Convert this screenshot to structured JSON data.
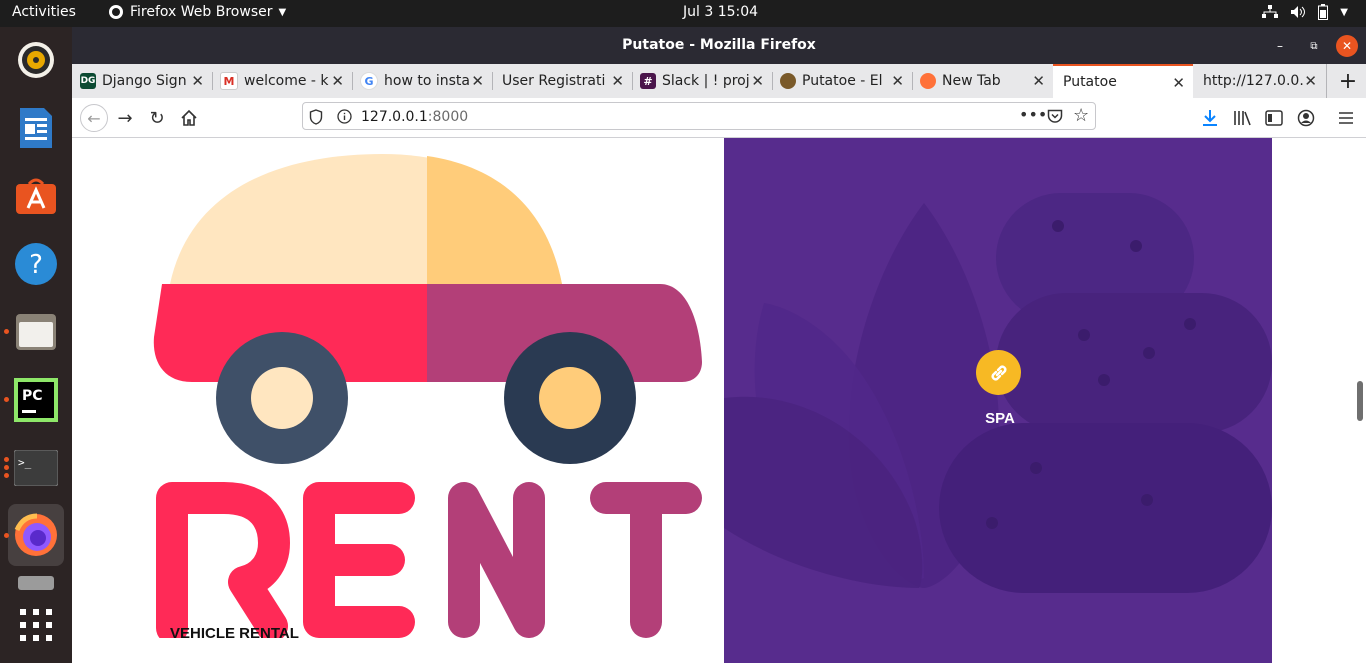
{
  "topbar": {
    "activities": "Activities",
    "app_menu": "Firefox Web Browser",
    "clock": "Jul 3  15:04"
  },
  "window": {
    "title": "Putatoe - Mozilla Firefox"
  },
  "tabs": [
    {
      "label": "Django Sign"
    },
    {
      "label": "welcome - k"
    },
    {
      "label": "how to insta"
    },
    {
      "label": "User Registrati"
    },
    {
      "label": "Slack | ! proj"
    },
    {
      "label": "Putatoe - El"
    },
    {
      "label": "New Tab"
    },
    {
      "label": "Putatoe"
    },
    {
      "label": "http://127.0.0."
    }
  ],
  "urlbar": {
    "host": "127.0.0.1",
    "port": ":8000"
  },
  "content": {
    "left_card_label": "VEHICLE RENTAL",
    "rent_text": "RENT",
    "right_card_label": "SPA"
  },
  "colors": {
    "accent": "#e95420",
    "spa_bg": "#572c8d",
    "spa_icon": "#f7b924",
    "car_red": "#ff2a57",
    "car_pink": "#b33f78",
    "car_cream": "#ffe6c0",
    "car_yellow": "#ffcc7a",
    "wheel_dark": "#3f5068"
  },
  "icons": [
    "volume-icon",
    "text-editor-icon",
    "software-store-icon",
    "help-icon",
    "files-icon",
    "pycharm-icon",
    "terminal-icon",
    "firefox-icon",
    "show-apps-icon"
  ]
}
